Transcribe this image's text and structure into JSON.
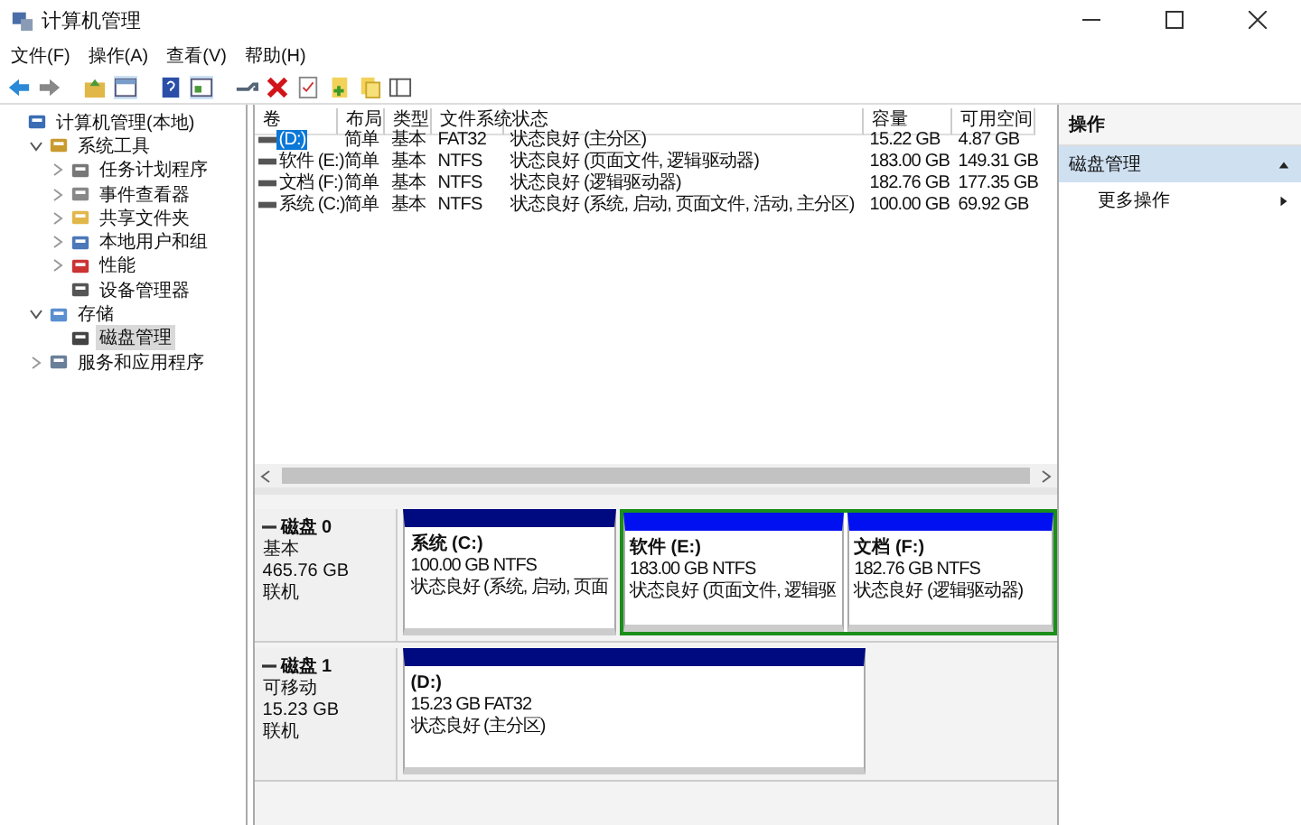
{
  "window": {
    "title": "计算机管理"
  },
  "menu": [
    "文件(F)",
    "操作(A)",
    "查看(V)",
    "帮助(H)"
  ],
  "tree": [
    {
      "label": "计算机管理(本地)",
      "kind": "computer",
      "selected": false,
      "children": [
        {
          "label": "系统工具",
          "kind": "tools",
          "expanded": true,
          "selected": false,
          "children": [
            {
              "label": "任务计划程序",
              "kind": "clock",
              "expanded": false,
              "selected": false
            },
            {
              "label": "事件查看器",
              "kind": "log",
              "expanded": false,
              "selected": false
            },
            {
              "label": "共享文件夹",
              "kind": "folder",
              "expanded": false,
              "selected": false
            },
            {
              "label": "本地用户和组",
              "kind": "users",
              "expanded": false,
              "selected": false
            },
            {
              "label": "性能",
              "kind": "perf",
              "expanded": false,
              "selected": false
            },
            {
              "label": "设备管理器",
              "kind": "device",
              "selected": false
            }
          ]
        },
        {
          "label": "存储",
          "kind": "storage",
          "expanded": true,
          "selected": false,
          "children": [
            {
              "label": "磁盘管理",
              "kind": "disk",
              "selected": true
            }
          ]
        },
        {
          "label": "服务和应用程序",
          "kind": "services",
          "expanded": false,
          "selected": false
        }
      ]
    }
  ],
  "volumes": {
    "columns": [
      "卷",
      "布局",
      "类型",
      "文件系统",
      "状态",
      "容量",
      "可用空间"
    ],
    "rows": [
      {
        "selected": true,
        "cells": [
          "(D:)",
          "简单",
          "基本",
          "FAT32",
          "状态良好 (主分区)",
          "15.22 GB",
          "4.87 GB"
        ]
      },
      {
        "selected": false,
        "cells": [
          "软件 (E:)",
          "简单",
          "基本",
          "NTFS",
          "状态良好 (页面文件, 逻辑驱动器)",
          "183.00 GB",
          "149.31 GB"
        ]
      },
      {
        "selected": false,
        "cells": [
          "文档 (F:)",
          "简单",
          "基本",
          "NTFS",
          "状态良好 (逻辑驱动器)",
          "182.76 GB",
          "177.35 GB"
        ]
      },
      {
        "selected": false,
        "cells": [
          "系统 (C:)",
          "简单",
          "基本",
          "NTFS",
          "状态良好 (系统, 启动, 页面文件, 活动, 主分区)",
          "100.00 GB",
          "69.92 GB"
        ]
      }
    ]
  },
  "disks": [
    {
      "name": "磁盘 0",
      "type": "基本",
      "size": "465.76 GB",
      "status": "联机",
      "partitions": [
        {
          "kind": "primary",
          "label": "系统  (C:)",
          "size_fs": "100.00 GB NTFS",
          "status": "状态良好 (系统, 启动, 页面"
        },
        {
          "kind": "extended",
          "children": [
            {
              "kind": "logical",
              "label": "软件  (E:)",
              "size_fs": "183.00 GB NTFS",
              "status": "状态良好 (页面文件, 逻辑驱"
            },
            {
              "kind": "logical",
              "label": "文档  (F:)",
              "size_fs": "182.76 GB NTFS",
              "status": "状态良好 (逻辑驱动器)"
            }
          ]
        }
      ]
    },
    {
      "name": "磁盘 1",
      "type": "可移动",
      "size": "15.23 GB",
      "status": "联机",
      "partitions": [
        {
          "kind": "primary",
          "label": "(D:)",
          "size_fs": "15.23 GB FAT32",
          "status": "状态良好 (主分区)"
        }
      ]
    }
  ],
  "actions": {
    "title": "操作",
    "sections": [
      {
        "label": "磁盘管理",
        "expanded": true,
        "items": [
          "更多操作"
        ]
      }
    ]
  }
}
